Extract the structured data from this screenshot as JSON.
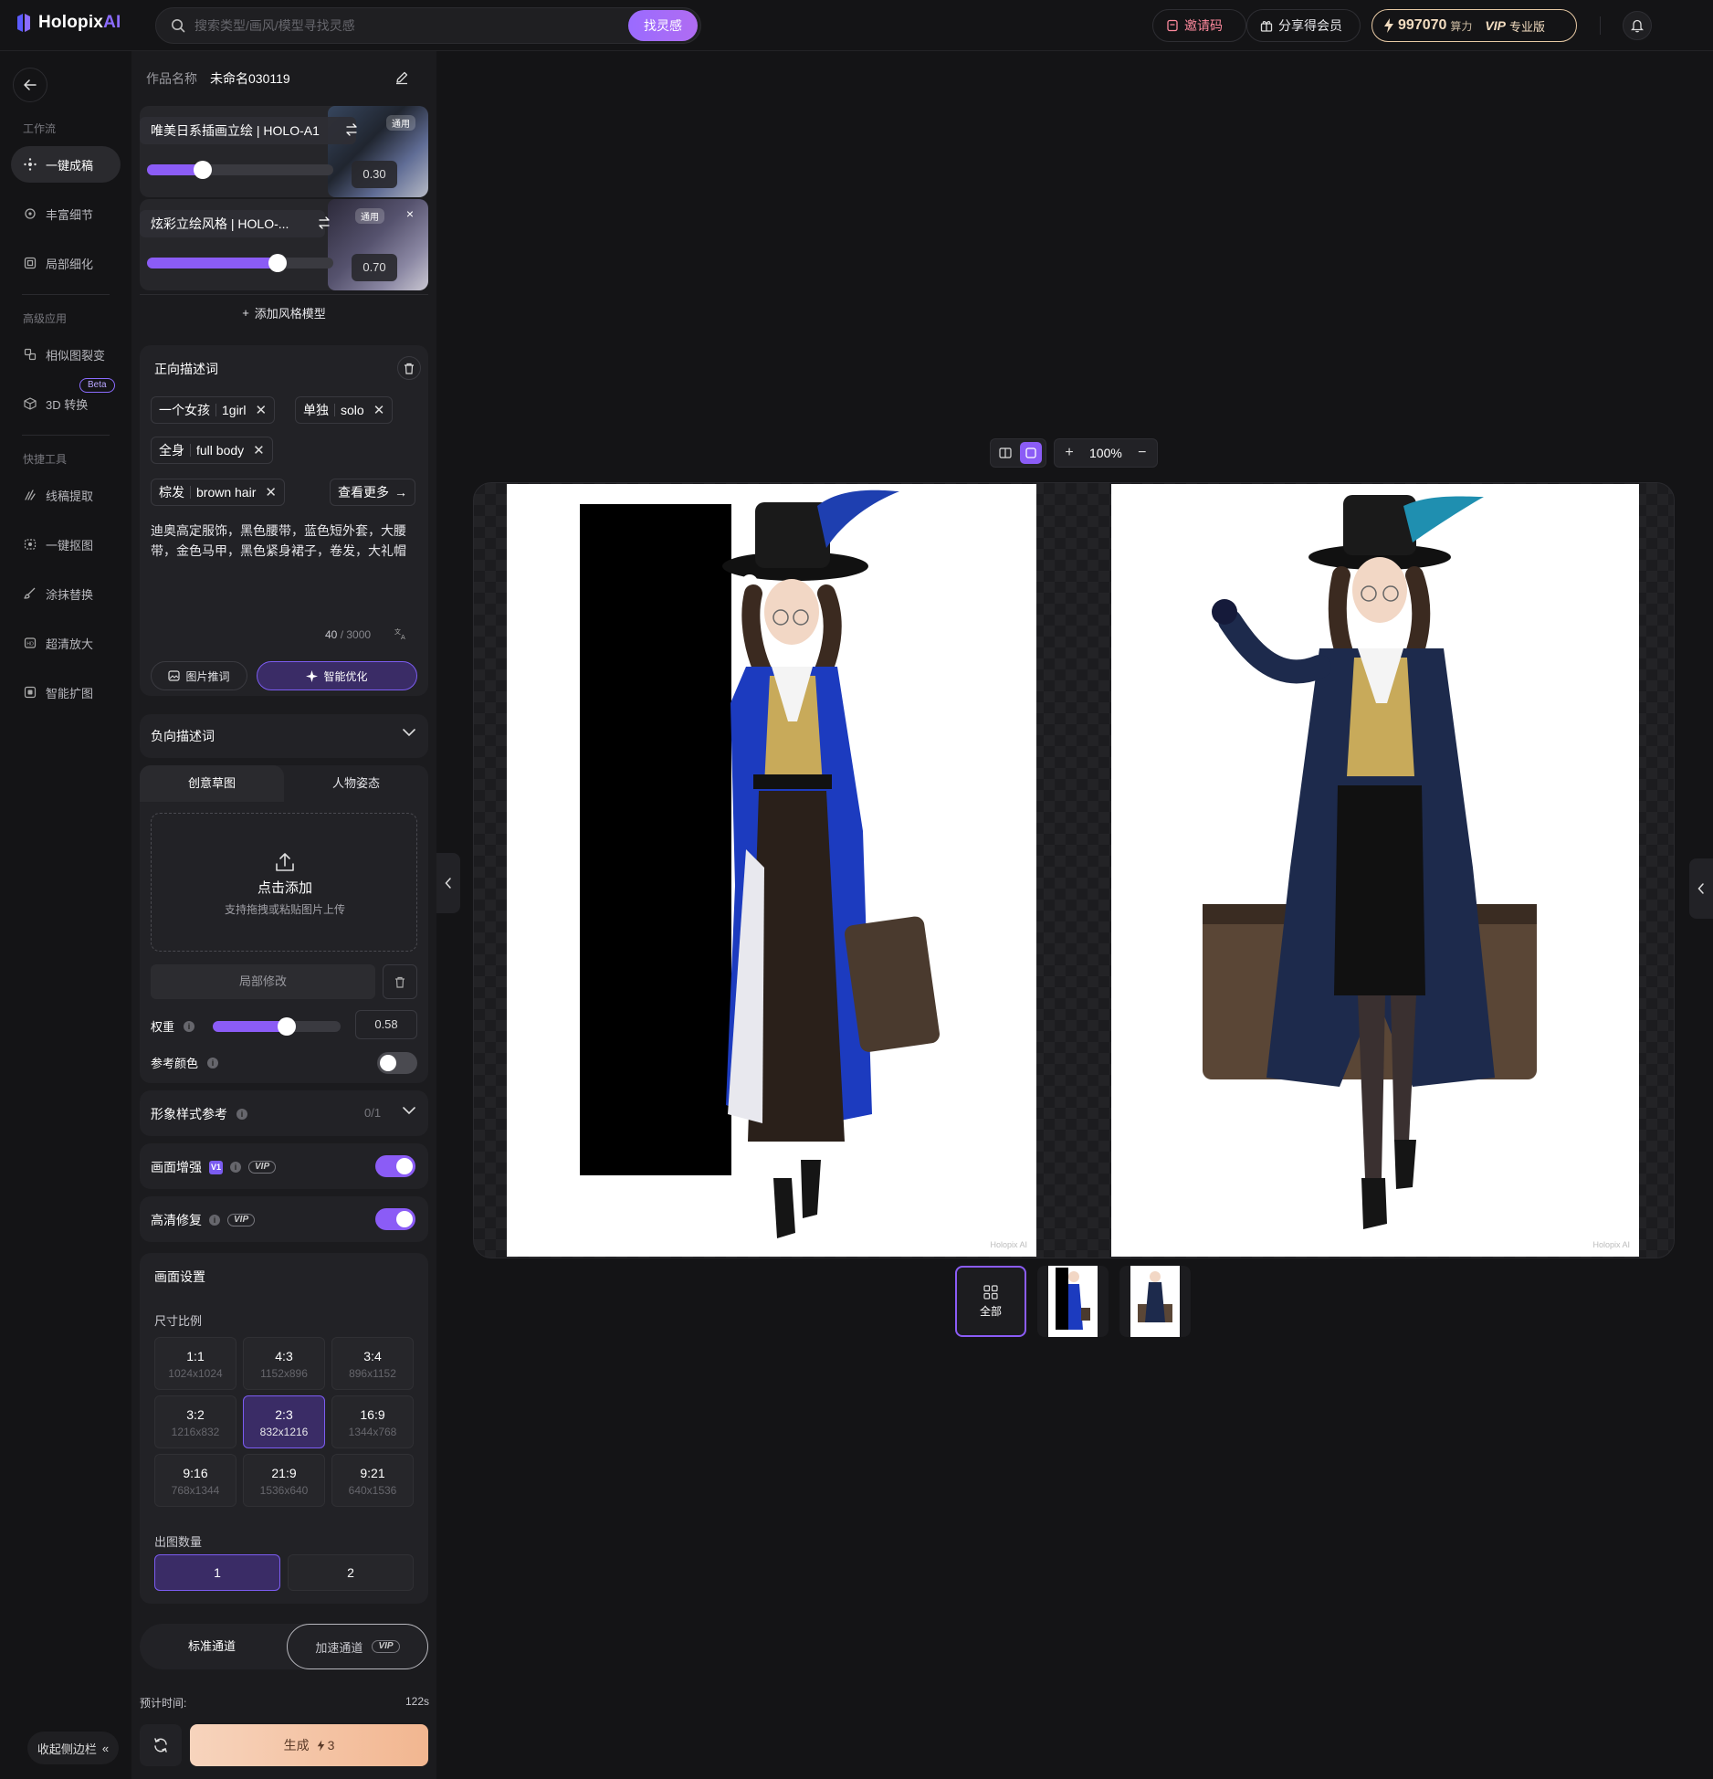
{
  "header": {
    "logo_text": "Holopix",
    "logo_suffix": "AI",
    "search_placeholder": "搜索类型/画风/模型寻找灵感",
    "inspire_label": "找灵感",
    "invite_label": "邀请码",
    "share_label": "分享得会员",
    "credits": "997070",
    "credits_unit": "算力",
    "vip_label": "VIP",
    "plan_label": "专业版"
  },
  "nav": {
    "group_workflow": "工作流",
    "group_advanced": "高级应用",
    "group_tools": "快捷工具",
    "items": [
      {
        "label": "一键成稿",
        "icon": "sparkle-icon"
      },
      {
        "label": "丰富细节",
        "icon": "detail-icon"
      },
      {
        "label": "局部细化",
        "icon": "refine-icon"
      },
      {
        "label": "相似图裂变",
        "icon": "variation-icon"
      },
      {
        "label": "3D 转换",
        "icon": "cube-icon"
      },
      {
        "label": "线稿提取",
        "icon": "lineart-icon"
      },
      {
        "label": "一键抠图",
        "icon": "cutout-icon"
      },
      {
        "label": "涂抹替换",
        "icon": "brush-icon"
      },
      {
        "label": "超清放大",
        "icon": "upscale-icon"
      },
      {
        "label": "智能扩图",
        "icon": "expand-icon"
      }
    ],
    "beta_badge": "Beta",
    "collapse_label": "收起侧边栏"
  },
  "panel": {
    "work_name_label": "作品名称",
    "work_name": "未命名030119",
    "models": [
      {
        "name": "唯美日系插画立绘 | HOLO-A1",
        "tag": "通用",
        "weight": 0.3,
        "weight_text": "0.30"
      },
      {
        "name": "炫彩立绘风格 | HOLO-...",
        "tag": "通用",
        "weight": 0.7,
        "weight_text": "0.70"
      }
    ],
    "add_style_label": "添加风格模型",
    "positive": {
      "title": "正向描述词",
      "tags": [
        {
          "zh": "一个女孩",
          "en": "1girl"
        },
        {
          "zh": "单独",
          "en": "solo"
        },
        {
          "zh": "全身",
          "en": "full body"
        },
        {
          "zh": "棕发",
          "en": "brown hair"
        }
      ],
      "see_more": "查看更多",
      "text": "迪奥高定服饰，黑色腰带，蓝色短外套，大腰带，金色马甲，黑色紧身裙子，卷发，大礼帽",
      "counter": "40",
      "counter_max": "/ 3000",
      "img2prompt": "图片推词",
      "optimize": "智能优化"
    },
    "negative_title": "负向描述词",
    "sketch": {
      "tab_sketch": "创意草图",
      "tab_pose": "人物姿态",
      "upload_title": "点击添加",
      "upload_hint": "支持拖拽或粘贴图片上传",
      "local_edit": "局部修改",
      "weight_label": "权重",
      "weight": 0.58,
      "weight_text": "0.58",
      "refcolor_label": "参考颜色",
      "refcolor_on": false
    },
    "style_ref": {
      "title": "形象样式参考",
      "count": "0/1"
    },
    "enhance": {
      "title": "画面增强",
      "version": "V1",
      "vip": "VIP",
      "on": true
    },
    "hd_fix": {
      "title": "高清修复",
      "vip": "VIP",
      "on": true
    },
    "canvas": {
      "title": "画面设置",
      "ratio_label": "尺寸比例",
      "ratios": [
        {
          "r": "1:1",
          "s": "1024x1024",
          "active": false
        },
        {
          "r": "4:3",
          "s": "1152x896",
          "active": false
        },
        {
          "r": "3:4",
          "s": "896x1152",
          "active": false
        },
        {
          "r": "3:2",
          "s": "1216x832",
          "active": false
        },
        {
          "r": "2:3",
          "s": "832x1216",
          "active": true
        },
        {
          "r": "16:9",
          "s": "1344x768",
          "active": false
        },
        {
          "r": "9:16",
          "s": "768x1344",
          "active": false
        },
        {
          "r": "21:9",
          "s": "1536x640",
          "active": false
        },
        {
          "r": "9:21",
          "s": "640x1536",
          "active": false
        }
      ],
      "count_label": "出图数量",
      "counts": [
        "1",
        "2"
      ],
      "count_selected": "1"
    },
    "channel_std": "标准通道",
    "channel_fast": "加速通道",
    "channel_fast_vip": "VIP",
    "eta_label": "预计时间:",
    "eta_value": "122s",
    "generate_label": "生成",
    "generate_cost": "3"
  },
  "viewer": {
    "zoom": "100%",
    "watermark": "Holopix AI",
    "thumb_all": "全部"
  },
  "colors": {
    "accent": "#8b5cf6",
    "background": "#141416",
    "generate_gradient": [
      "#f7d4bd",
      "#f2b690"
    ],
    "credits_gold": "#e7c9a4"
  }
}
